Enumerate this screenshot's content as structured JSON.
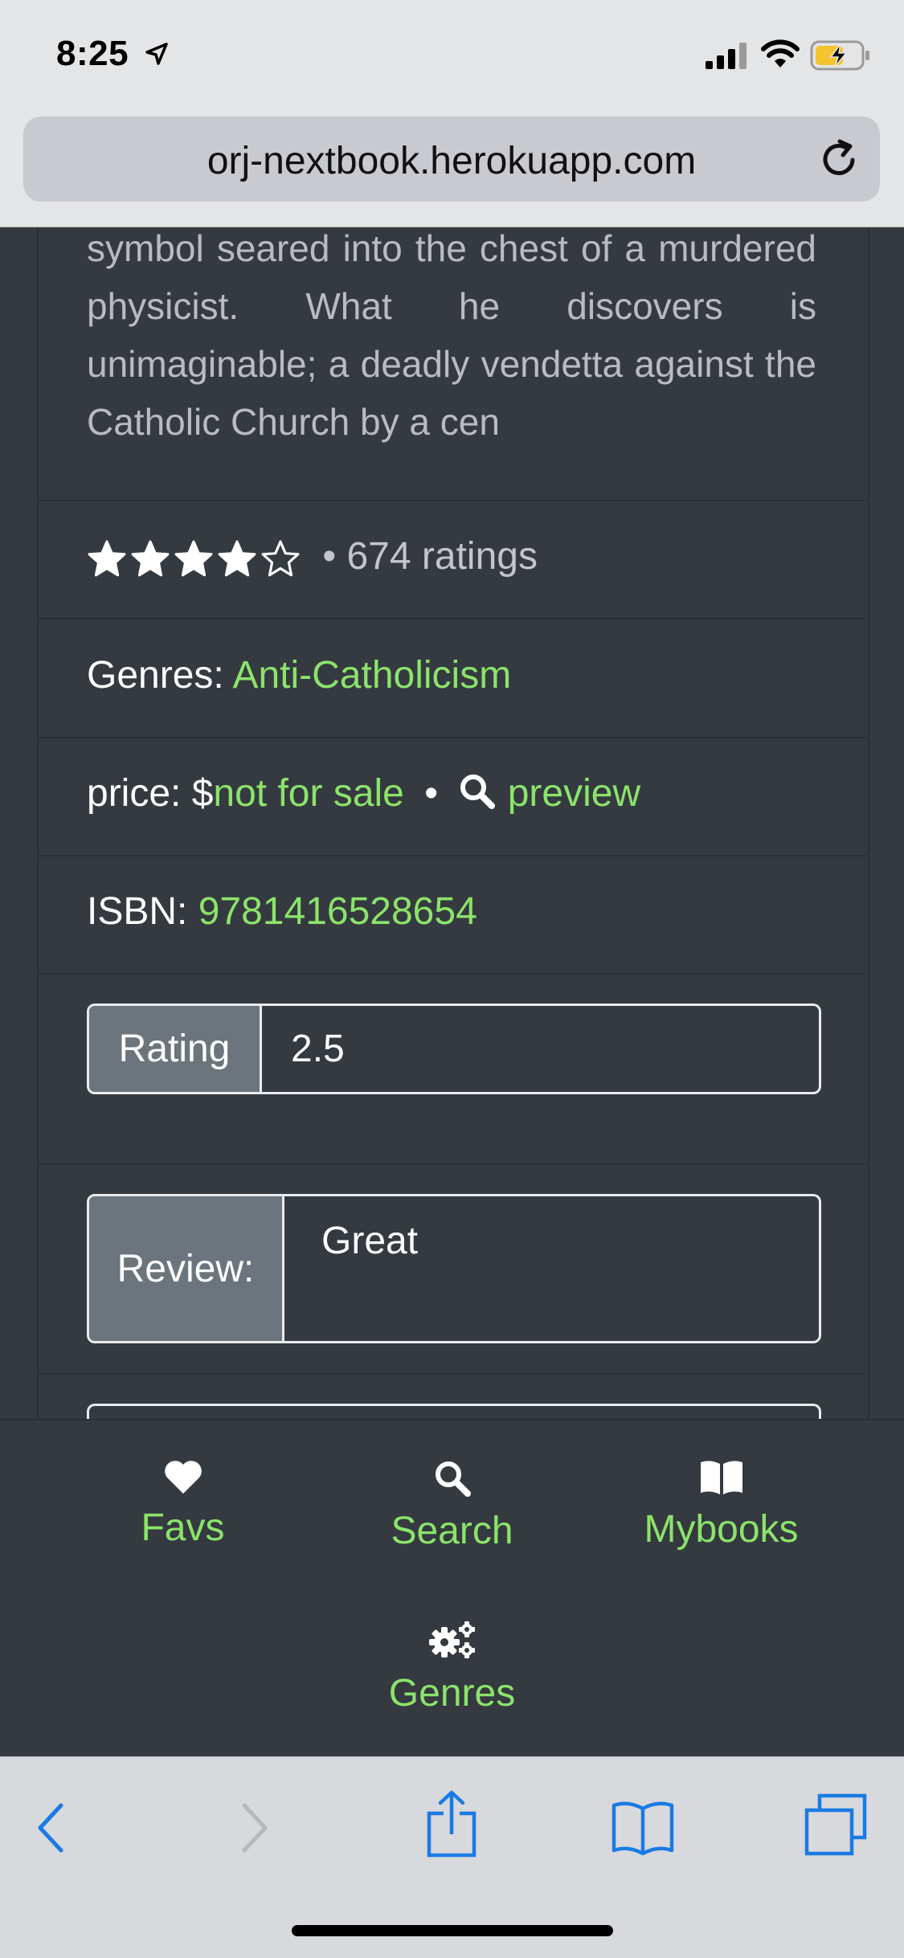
{
  "status_bar": {
    "time": "8:25"
  },
  "browser": {
    "url": "orj-nextbook.herokuapp.com"
  },
  "book": {
    "description": "symbol seared into the chest of a murdered physicist. What he discovers is unimaginable; a deadly vendetta against the Catholic Church by a cen",
    "rating_stars": 4,
    "rating_max": 5,
    "ratings_text": "• 674 ratings",
    "genres_label": "Genres:",
    "genres_value": "Anti-Catholicism",
    "price_label": "price: $",
    "price_value": "not for sale",
    "price_sep": "•",
    "preview_label": "preview",
    "isbn_label": "ISBN:",
    "isbn_value": "9781416528654"
  },
  "rating_field": {
    "label": "Rating",
    "value": "2.5"
  },
  "review_field": {
    "label": "Review:",
    "value": "Great"
  },
  "app_nav": {
    "items": [
      {
        "label": "Favs",
        "icon": "heart-icon"
      },
      {
        "label": "Search",
        "icon": "search-icon"
      },
      {
        "label": "Mybooks",
        "icon": "book-open-icon"
      },
      {
        "label": "Genres",
        "icon": "cogs-icon"
      }
    ]
  },
  "colors": {
    "accent": "#8ce36b",
    "background": "#343a40",
    "ios_blue": "#1a7be4"
  }
}
